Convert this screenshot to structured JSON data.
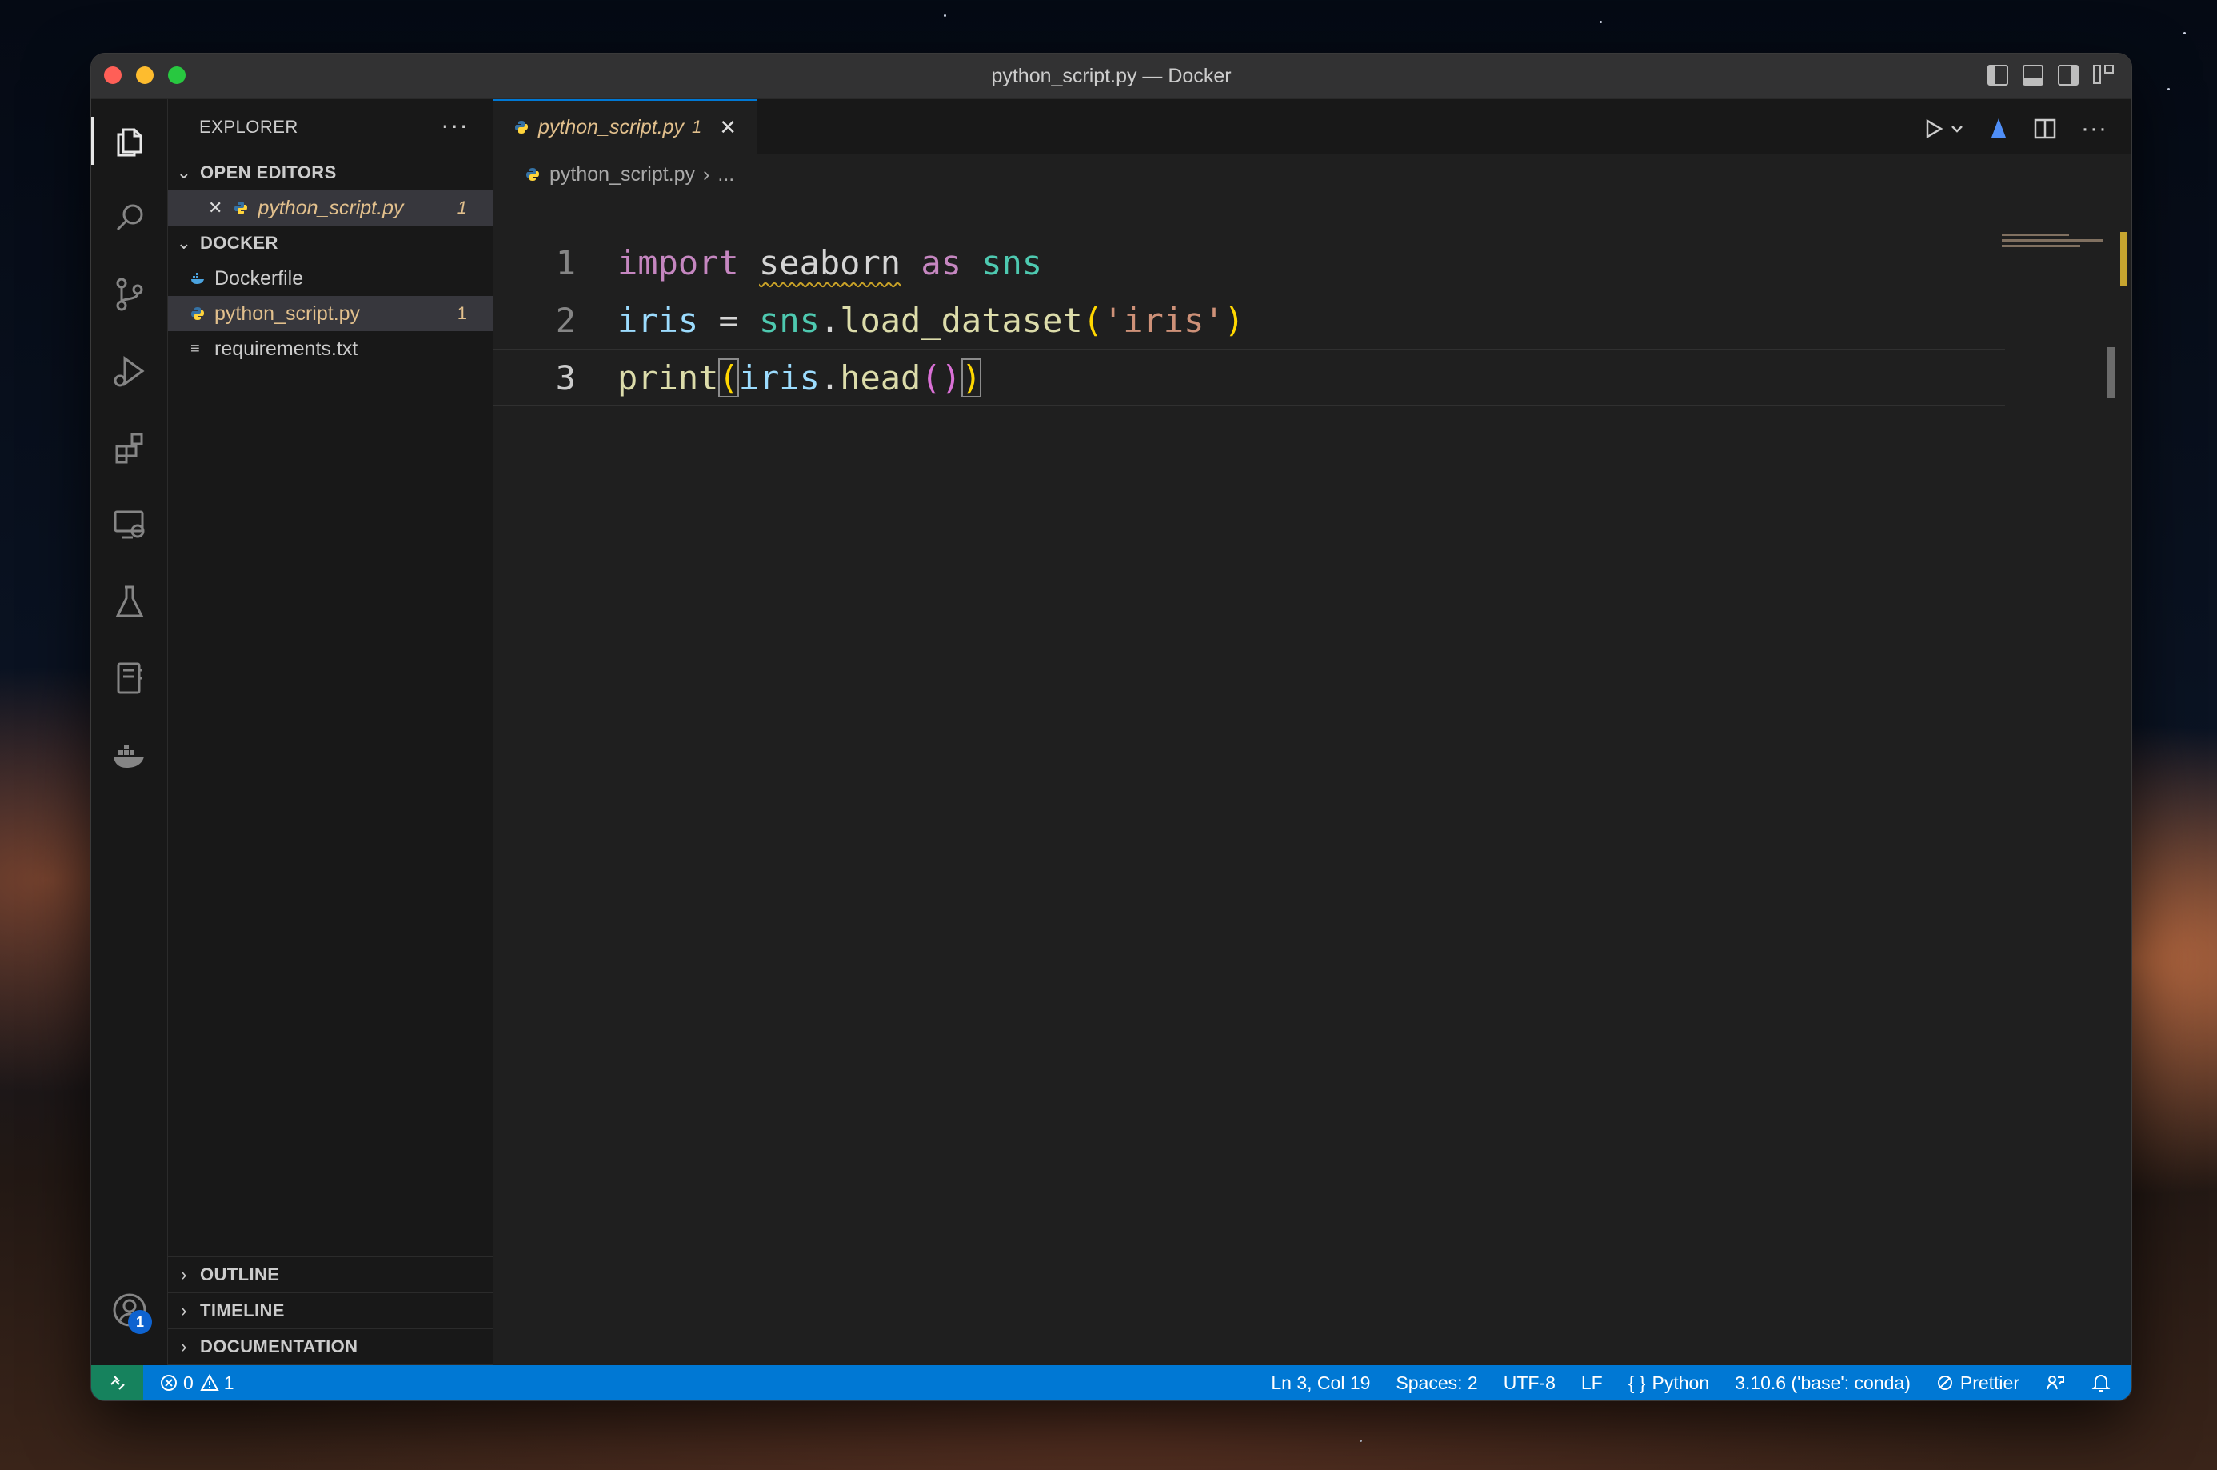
{
  "window": {
    "title": "python_script.py — Docker"
  },
  "sidebar": {
    "header": "EXPLORER",
    "more": "···",
    "open_editors": {
      "label": "OPEN EDITORS",
      "items": [
        {
          "name": "python_script.py",
          "count": "1"
        }
      ]
    },
    "folder": {
      "label": "DOCKER",
      "items": [
        {
          "name": "Dockerfile",
          "count": ""
        },
        {
          "name": "python_script.py",
          "count": "1"
        },
        {
          "name": "requirements.txt",
          "count": ""
        }
      ]
    },
    "panels": [
      "OUTLINE",
      "TIMELINE",
      "DOCUMENTATION"
    ]
  },
  "activity": {
    "accounts_badge": "1"
  },
  "editor": {
    "tab": {
      "name": "python_script.py",
      "count": "1",
      "close": "✕"
    },
    "breadcrumb": {
      "file": "python_script.py",
      "sep": "›",
      "rest": "..."
    },
    "lines": [
      {
        "num": "1",
        "t": [
          "import",
          " ",
          "seaborn",
          " ",
          "as",
          " ",
          "sns"
        ]
      },
      {
        "num": "2",
        "t": [
          "iris",
          " ",
          "=",
          " ",
          "sns",
          ".",
          "load_dataset",
          "(",
          "'iris'",
          ")"
        ]
      },
      {
        "num": "3",
        "t": [
          "print",
          "(",
          "iris",
          ".",
          "head",
          "(",
          ")",
          ")"
        ]
      }
    ]
  },
  "status": {
    "errors": "0",
    "warnings": "1",
    "position": "Ln 3, Col 19",
    "spaces": "Spaces: 2",
    "encoding": "UTF-8",
    "eol": "LF",
    "language": "Python",
    "interpreter": "3.10.6 ('base': conda)",
    "formatter": "Prettier"
  },
  "colors": {
    "accent": "#0078d4",
    "remote": "#16825d",
    "modified": "#e2c08d",
    "keyword": "#c586c0",
    "class": "#4ec9b0",
    "variable": "#9cdcfe",
    "function": "#dcdcaa",
    "string": "#ce9178"
  }
}
